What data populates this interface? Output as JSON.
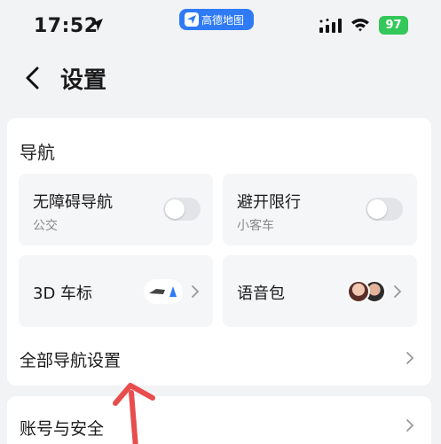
{
  "status_bar": {
    "time": "17:52",
    "app_pill_label": "高德地图",
    "battery": "97"
  },
  "header": {
    "title": "设置"
  },
  "navigation_section": {
    "title": "导航",
    "tiles": [
      {
        "title": "无障碍导航",
        "subtitle": "公交",
        "toggle_on": false
      },
      {
        "title": "避开限行",
        "subtitle": "小客车",
        "toggle_on": false
      },
      {
        "title": "3D 车标"
      },
      {
        "title": "语音包"
      }
    ],
    "all_settings_label": "全部导航设置"
  },
  "account_row": {
    "label": "账号与安全"
  },
  "colors": {
    "accent": "#2f7bf5",
    "battery": "#34c759",
    "annotation_arrow": "#e84d4d"
  },
  "icons": [
    "location-arrow-icon",
    "signal-icon",
    "wifi-icon",
    "back-chevron-icon",
    "chevron-right-icon"
  ]
}
